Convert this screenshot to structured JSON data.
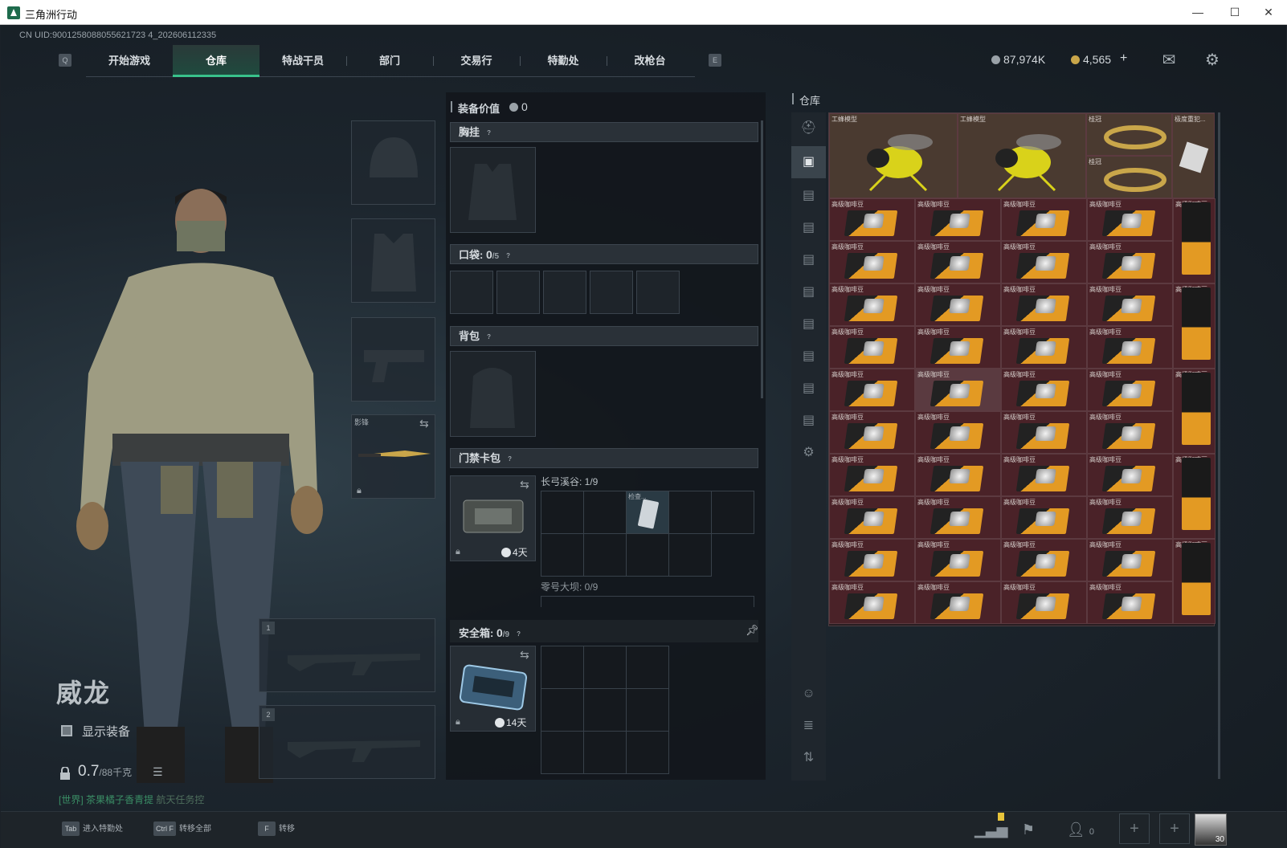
{
  "window": {
    "title": "三角洲行动",
    "minimize": "—",
    "maximize": "☐",
    "close": "✕"
  },
  "uid": "CN UID:9001258088055621723 4_202606112335",
  "nav": {
    "left_key": "Q",
    "right_key": "E",
    "tabs": [
      "开始游戏",
      "仓库",
      "特战干员",
      "部门",
      "交易行",
      "特勤处",
      "改枪台"
    ],
    "active": "仓库"
  },
  "currency": {
    "silver": "87,974K",
    "gold": "4,565",
    "plus": "+"
  },
  "character": {
    "name": "威龙",
    "show_equipment": "显示装备",
    "weight": "0.7",
    "weight_max": "/88千克",
    "chat_world": "[世界]",
    "chat_name": "茶果橘子香青提",
    "chat_msg": "航天任务控"
  },
  "gear": {
    "melee_label": "影锋",
    "slot1": "1",
    "slot2": "2"
  },
  "loadout": {
    "equip_value_label": "装备价值",
    "equip_value": "0",
    "chest_rig": "胸挂",
    "pockets": "口袋: ",
    "pockets_count": "0",
    "pockets_max": "/5",
    "backpack": "背包",
    "keycard": "门禁卡包",
    "keycard_days": "4天",
    "map1": "长弓溪谷: 1/9",
    "card_item": "检查...",
    "map2": "零号大坝: 0/9",
    "safe": "安全箱: ",
    "safe_count": "0",
    "safe_max": "/9",
    "safe_days": "14天"
  },
  "inventory": {
    "title": "仓库",
    "gold_items": [
      "工蜂模型",
      "工蜂模型",
      "桂冠",
      "极度重犯..."
    ],
    "second_crown": "桂冠",
    "bag_name": "高级咖啡豆"
  },
  "bottom": {
    "hints": [
      {
        "key": "Tab",
        "label": "进入特勤处"
      },
      {
        "key": "Ctrl F",
        "label": "转移全部"
      },
      {
        "key": "F",
        "label": "转移"
      }
    ],
    "friends_count": "0",
    "avatar_level": "30"
  },
  "colors": {
    "accent": "#39c28b",
    "item_bg": "#4a2228",
    "gold_bg": "#4a3a30"
  }
}
